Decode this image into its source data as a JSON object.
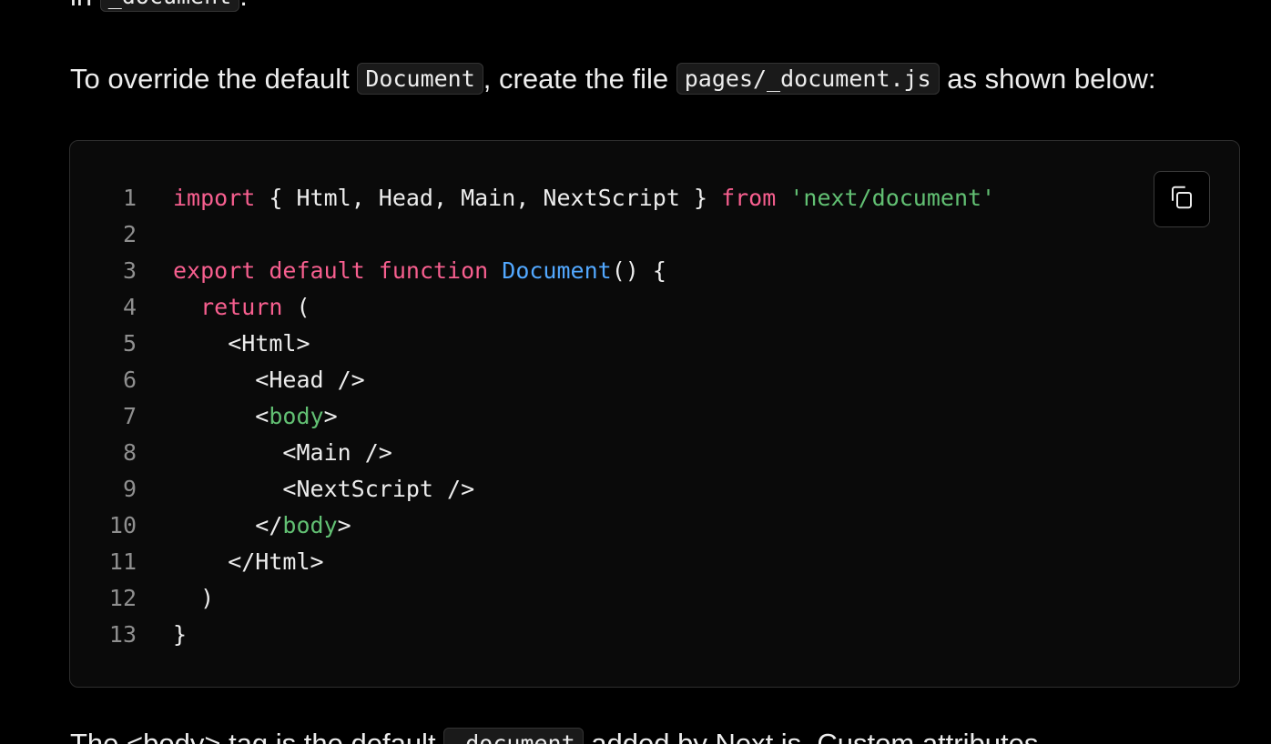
{
  "prose_top": {
    "prefix": "in ",
    "code": "_document",
    "suffix": "."
  },
  "prose_main": {
    "text_1": "To override the default ",
    "code_1": "Document",
    "text_2": ", create the file ",
    "code_2": "pages/_document.js",
    "text_3": " as shown below:"
  },
  "prose_bottom": {
    "text_1": "The <body> tag is the default ",
    "code_1": "_document",
    "text_2": " added by Next.js. Custom attributes"
  },
  "copy_button": {
    "icon": "copy-icon"
  },
  "code_block": {
    "language": "jsx",
    "lines": [
      {
        "n": "1",
        "tokens": [
          {
            "t": "import",
            "k": "keyword"
          },
          {
            "t": " { Html, Head, Main, NextScript } ",
            "k": "plain"
          },
          {
            "t": "from",
            "k": "keyword"
          },
          {
            "t": " ",
            "k": "plain"
          },
          {
            "t": "'next/document'",
            "k": "string"
          }
        ]
      },
      {
        "n": "2",
        "tokens": []
      },
      {
        "n": "3",
        "tokens": [
          {
            "t": "export",
            "k": "keyword"
          },
          {
            "t": " ",
            "k": "plain"
          },
          {
            "t": "default",
            "k": "keyword"
          },
          {
            "t": " ",
            "k": "plain"
          },
          {
            "t": "function",
            "k": "keyword"
          },
          {
            "t": " ",
            "k": "plain"
          },
          {
            "t": "Document",
            "k": "function"
          },
          {
            "t": "() {",
            "k": "plain"
          }
        ]
      },
      {
        "n": "4",
        "tokens": [
          {
            "t": "  ",
            "k": "plain"
          },
          {
            "t": "return",
            "k": "keyword"
          },
          {
            "t": " (",
            "k": "plain"
          }
        ]
      },
      {
        "n": "5",
        "tokens": [
          {
            "t": "    <Html>",
            "k": "plain"
          }
        ]
      },
      {
        "n": "6",
        "tokens": [
          {
            "t": "      <Head />",
            "k": "plain"
          }
        ]
      },
      {
        "n": "7",
        "tokens": [
          {
            "t": "      <",
            "k": "plain"
          },
          {
            "t": "body",
            "k": "tag"
          },
          {
            "t": ">",
            "k": "plain"
          }
        ]
      },
      {
        "n": "8",
        "tokens": [
          {
            "t": "        <Main />",
            "k": "plain"
          }
        ]
      },
      {
        "n": "9",
        "tokens": [
          {
            "t": "        <NextScript />",
            "k": "plain"
          }
        ]
      },
      {
        "n": "10",
        "tokens": [
          {
            "t": "      </",
            "k": "plain"
          },
          {
            "t": "body",
            "k": "tag"
          },
          {
            "t": ">",
            "k": "plain"
          }
        ]
      },
      {
        "n": "11",
        "tokens": [
          {
            "t": "    </Html>",
            "k": "plain"
          }
        ]
      },
      {
        "n": "12",
        "tokens": [
          {
            "t": "  )",
            "k": "plain"
          }
        ]
      },
      {
        "n": "13",
        "tokens": [
          {
            "t": "}",
            "k": "plain"
          }
        ]
      }
    ]
  },
  "colors": {
    "background": "#000000",
    "code_background": "#0a0a0a",
    "keyword": "#f75f8f",
    "string": "#62c073",
    "function": "#52a8ff",
    "text": "#ededed",
    "line_number": "#8f8f8f"
  }
}
